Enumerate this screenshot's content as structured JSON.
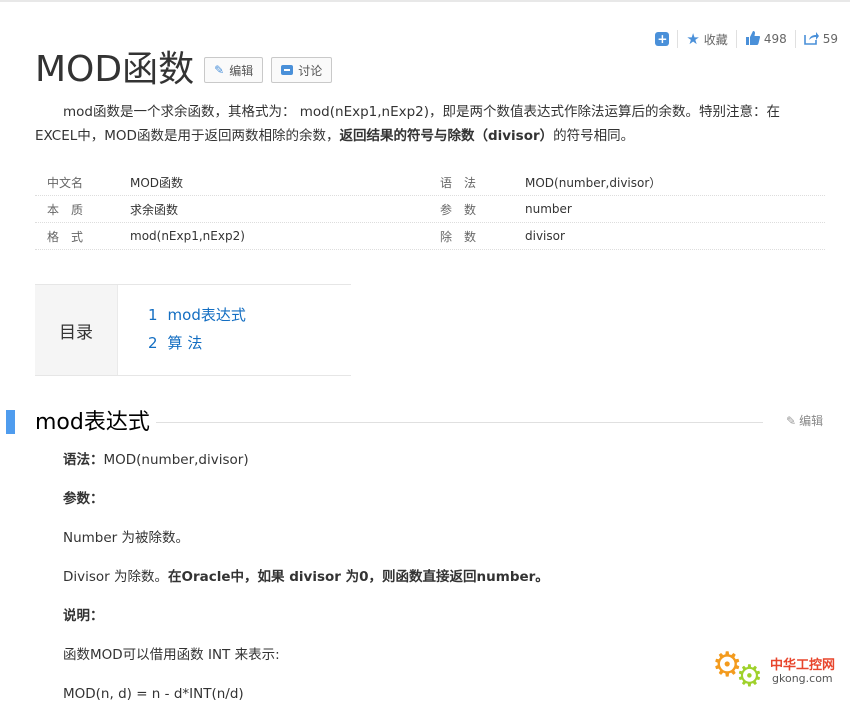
{
  "toolbar": {
    "favorite_label": "收藏",
    "like_count": "498",
    "share_count": "59"
  },
  "title": {
    "text": "MOD函数",
    "edit_label": "编辑",
    "discuss_label": "讨论"
  },
  "summary": {
    "part1": "mod函数是一个求余函数，其格式为： mod(nExp1,nExp2)，即是两个数值表达式作除法运算后的余数。特别注意：在EXCEL中，MOD函数是用于返回两数相除的余数，",
    "bold": "返回结果的符号与除数（divisor）",
    "part2": "的符号相同。"
  },
  "info": [
    {
      "k1": "中文名",
      "v1": "MOD函数",
      "k2": "语　法",
      "v2": "MOD(number,divisor）"
    },
    {
      "k1": "本　质",
      "v1": "求余函数",
      "k2": "参　数",
      "v2": "number"
    },
    {
      "k1": "格　式",
      "v1": "mod(nExp1,nExp2)",
      "k2": "除　数",
      "v2": "divisor"
    }
  ],
  "toc": {
    "label": "目录",
    "items": [
      {
        "num": "1",
        "text": "mod表达式"
      },
      {
        "num": "2",
        "text": "算 法"
      }
    ]
  },
  "section": {
    "title": "mod表达式",
    "edit_label": "编辑"
  },
  "body": {
    "syntax_label": "语法：",
    "syntax_value": "MOD(number,divisor)",
    "params_label": "参数：",
    "number_line": "Number 为被除数。",
    "divisor_plain": "Divisor 为除数。",
    "divisor_bold": "在Oracle中，如果 divisor 为0，则函数直接返回number。",
    "note_label": "说明：",
    "note_text": "函数MOD可以借用函数 INT 来表示:",
    "formula": "MOD(n, d) = n - d*INT(n/d)"
  },
  "watermark": {
    "cn": "中华工控网",
    "en": "gkong.com"
  },
  "colors": {
    "accent": "#4a90d9",
    "link": "#136ec2",
    "section_bar": "#4f9cee"
  }
}
